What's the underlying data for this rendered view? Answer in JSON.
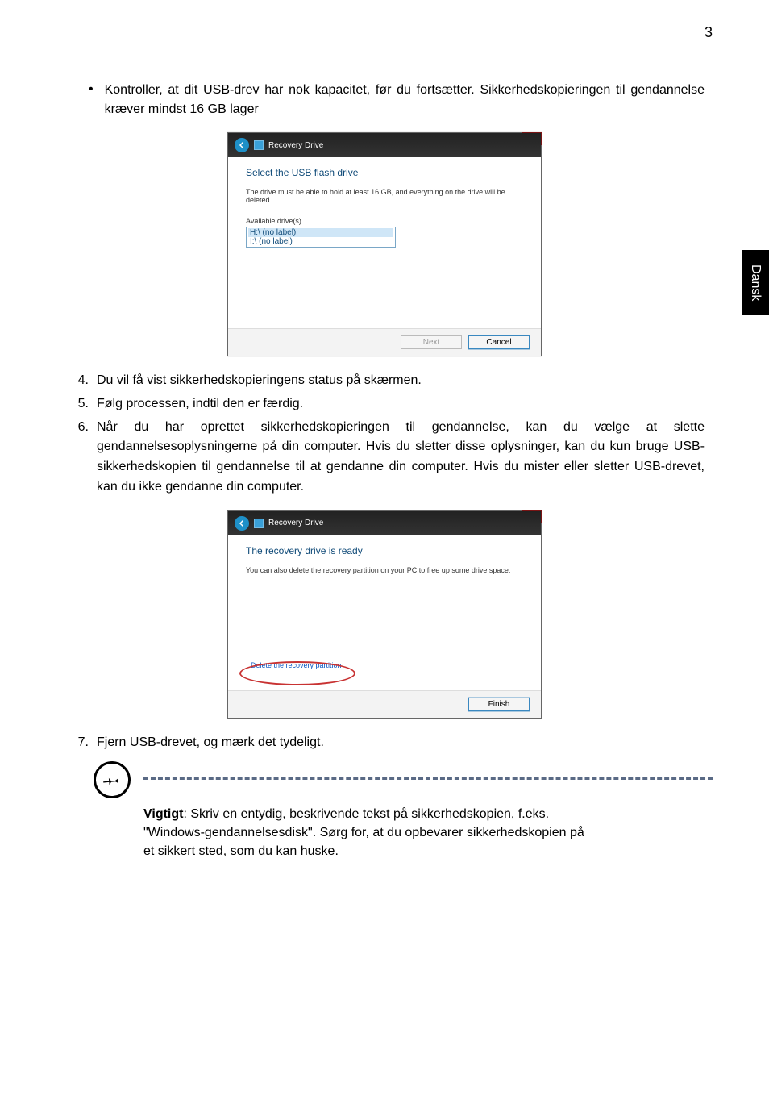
{
  "page_number": "3",
  "side_tab": "Dansk",
  "bullet": {
    "marker": "•",
    "text": "Kontroller, at dit USB-drev har nok kapacitet, før du fortsætter. Sikkerhedskopieringen til gendannelse kræver mindst 16 GB lager"
  },
  "dialog1": {
    "title_bar": "Recovery Drive",
    "close": "x",
    "heading": "Select the USB flash drive",
    "desc": "The drive must be able to hold at least 16 GB, and everything on the drive will be deleted.",
    "available_label": "Available drive(s)",
    "drives": [
      "H:\\ (no label)",
      "I:\\ (no label)"
    ],
    "next": "Next",
    "cancel": "Cancel"
  },
  "steps": [
    {
      "n": "4.",
      "t": "Du vil få vist sikkerhedskopieringens status på skærmen."
    },
    {
      "n": "5.",
      "t": "Følg processen, indtil den er færdig."
    },
    {
      "n": "6.",
      "t": "Når du har oprettet sikkerhedskopieringen til gendannelse, kan du vælge at slette gendannelsesoplysningerne på din computer. Hvis du sletter disse oplysninger, kan du kun bruge USB-sikkerhedskopien til gendannelse til at gendanne din computer. Hvis du mister eller sletter USB-drevet, kan du ikke gendanne din computer."
    }
  ],
  "dialog2": {
    "title_bar": "Recovery Drive",
    "close": "x",
    "heading": "The recovery drive is ready",
    "desc": "You can also delete the recovery partition on your PC to free up some drive space.",
    "delete_link": "Delete the recovery partition",
    "finish": "Finish"
  },
  "step7": {
    "n": "7.",
    "t": "Fjern USB-drevet, og mærk det tydeligt."
  },
  "note": {
    "label": "Vigtigt",
    "text": ": Skriv en entydig, beskrivende tekst på sikkerhedskopien, f.eks. \"Windows-gendannelsesdisk\". Sørg for, at du opbevarer sikkerhedskopien på et sikkert sted, som du kan huske."
  }
}
